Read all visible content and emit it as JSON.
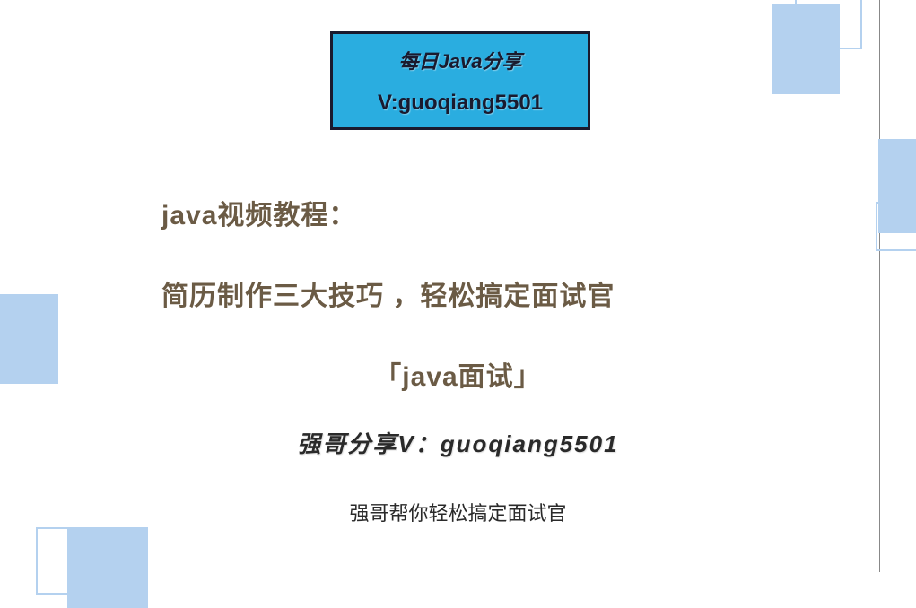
{
  "header": {
    "line1": "每日Java分享",
    "line2": "V:guoqiang5501"
  },
  "title": {
    "line1": "java视频教程：",
    "line2": "简历制作三大技巧 ，轻松搞定面试官",
    "line3": "「java面试」"
  },
  "subtitle": "强哥分享V：guoqiang5501",
  "footer": "强哥帮你轻松搞定面试官"
}
